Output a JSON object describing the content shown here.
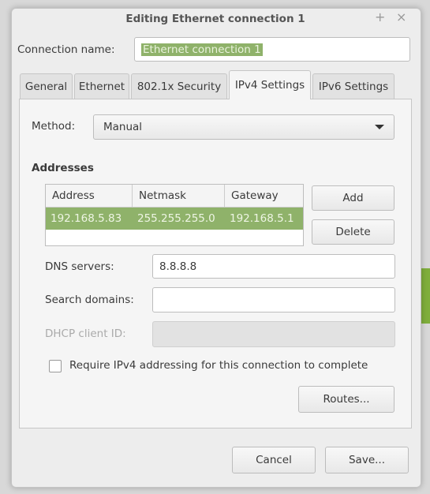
{
  "window": {
    "title": "Editing Ethernet connection 1",
    "maximize_icon": "+",
    "close_icon": "×"
  },
  "connection": {
    "label": "Connection name:",
    "value": "Ethernet connection 1"
  },
  "tabs": [
    {
      "label": "General"
    },
    {
      "label": "Ethernet"
    },
    {
      "label": "802.1x Security"
    },
    {
      "label": "IPv4 Settings",
      "active": true
    },
    {
      "label": "IPv6 Settings"
    }
  ],
  "ipv4": {
    "method_label": "Method:",
    "method_value": "Manual",
    "addresses_heading": "Addresses",
    "columns": [
      "Address",
      "Netmask",
      "Gateway"
    ],
    "rows": [
      [
        "192.168.5.83",
        "255.255.255.0",
        "192.168.5.1"
      ]
    ],
    "add_label": "Add",
    "delete_label": "Delete",
    "dns_label": "DNS servers:",
    "dns_value": "8.8.8.8",
    "search_label": "Search domains:",
    "search_value": "",
    "dhcp_label": "DHCP client ID:",
    "dhcp_value": "",
    "require_label": "Require IPv4 addressing for this connection to complete",
    "require_checked": false,
    "routes_label": "Routes..."
  },
  "footer": {
    "cancel_label": "Cancel",
    "save_label": "Save..."
  },
  "colors": {
    "selection": "#8fb26a",
    "accent_green": "#7fae3c"
  }
}
